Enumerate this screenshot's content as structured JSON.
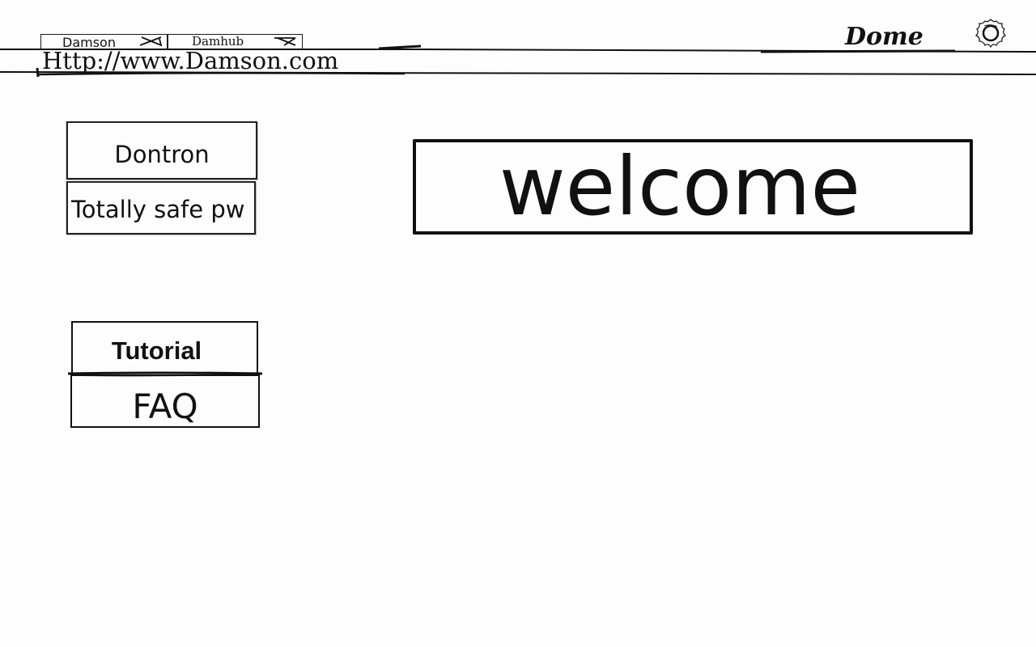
{
  "browser": {
    "tabs": [
      {
        "label": "Damson"
      },
      {
        "label": "Damhub"
      }
    ],
    "url": "Http://www.Damson.com"
  },
  "header": {
    "brand": "Dome",
    "settings_icon": "gear-icon"
  },
  "login": {
    "username_value": "Dontron",
    "password_value": "Totally safe pw"
  },
  "main": {
    "welcome_text": "welcome"
  },
  "nav": {
    "items": [
      {
        "label": "Tutorial"
      },
      {
        "label": "FAQ"
      }
    ]
  },
  "colors": {
    "ink": "#111111",
    "paper": "#fdfdfd"
  }
}
